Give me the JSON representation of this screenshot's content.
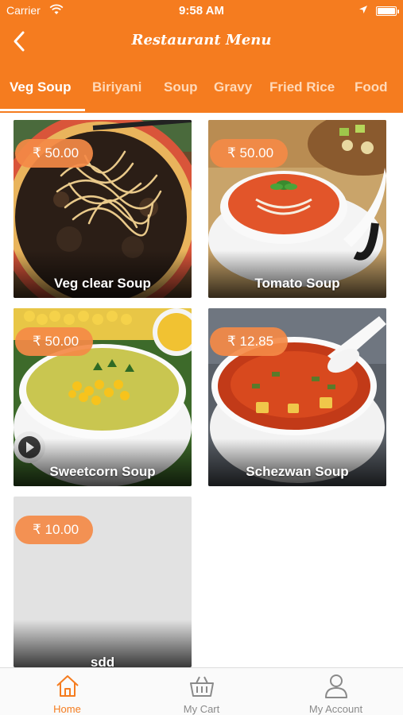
{
  "status_bar": {
    "carrier": "Carrier",
    "time": "9:58 AM"
  },
  "header": {
    "title": "Restaurant Menu",
    "back_icon": "chevron-left-icon"
  },
  "tabs": [
    {
      "label": "Veg Soup",
      "active": true
    },
    {
      "label": "Biriyani"
    },
    {
      "label": "Soup"
    },
    {
      "label": "Gravy"
    },
    {
      "label": "Fried Rice"
    },
    {
      "label": "Food"
    }
  ],
  "menu_items": [
    {
      "name": "Veg clear Soup",
      "price": "₹ 50.00"
    },
    {
      "name": "Tomato Soup",
      "price": "₹ 50.00"
    },
    {
      "name": "Sweetcorn Soup",
      "price": "₹ 50.00"
    },
    {
      "name": "Schezwan Soup",
      "price": "₹ 12.85"
    },
    {
      "name": "sdd",
      "price": "₹ 10.00"
    }
  ],
  "bottom_nav": [
    {
      "label": "Home",
      "icon": "home-icon",
      "active": true
    },
    {
      "label": "My Cart",
      "icon": "basket-icon"
    },
    {
      "label": "My Account",
      "icon": "user-icon"
    }
  ],
  "colors": {
    "brand": "#f57c1f",
    "badge": "#f48a46",
    "inactive_nav": "#8a8a8a"
  }
}
